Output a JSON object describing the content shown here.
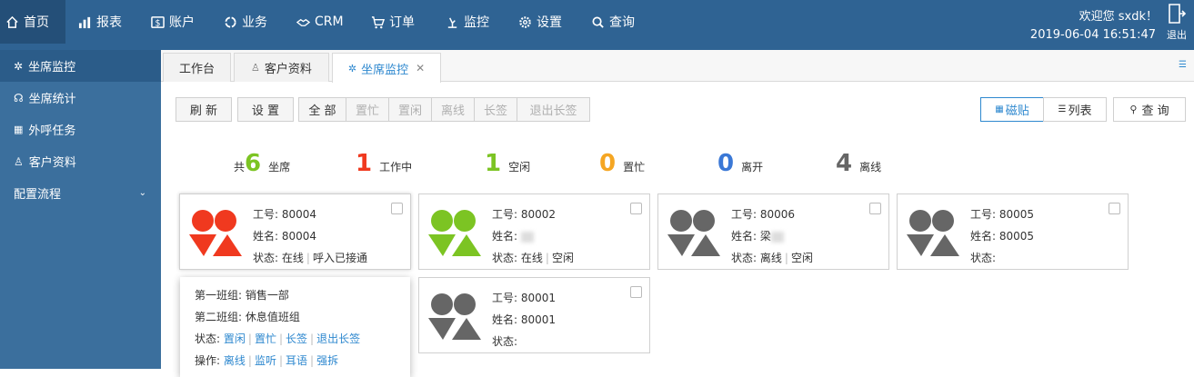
{
  "nav": {
    "items": [
      {
        "label": "首页",
        "icon": "home-icon"
      },
      {
        "label": "报表",
        "icon": "chart-icon"
      },
      {
        "label": "账户",
        "icon": "dollar-icon"
      },
      {
        "label": "业务",
        "icon": "refresh-icon"
      },
      {
        "label": "CRM",
        "icon": "handshake-icon"
      },
      {
        "label": "订单",
        "icon": "cart-icon"
      },
      {
        "label": "监控",
        "icon": "monitor-icon"
      },
      {
        "label": "设置",
        "icon": "gear-icon"
      },
      {
        "label": "查询",
        "icon": "search-icon"
      }
    ],
    "welcome": "欢迎您 sxdk！",
    "datetime": "2019-06-04 16:51:47",
    "logout": "退出"
  },
  "sidebar": {
    "items": [
      {
        "label": "坐席监控",
        "icon": "agent-icon"
      },
      {
        "label": "坐席统计",
        "icon": "headset-icon"
      },
      {
        "label": "外呼任务",
        "icon": "grid-icon"
      },
      {
        "label": "客户资料",
        "icon": "user-icon"
      },
      {
        "label": "配置流程",
        "icon": ""
      }
    ]
  },
  "tabs": [
    {
      "label": "工作台"
    },
    {
      "label": "客户资料"
    },
    {
      "label": "坐席监控"
    }
  ],
  "toolbar": {
    "refresh": "刷 新",
    "settings": "设 置",
    "filters": [
      "全 部",
      "置忙",
      "置闲",
      "离线",
      "长签",
      "退出长签"
    ],
    "view_tile": "磁贴",
    "view_list": "列表",
    "query": "查 询"
  },
  "stats": {
    "total_prefix": "共",
    "total": "6",
    "total_label": "坐席",
    "working": "1",
    "working_label": "工作中",
    "idle": "1",
    "idle_label": "空闲",
    "busy": "0",
    "busy_label": "置忙",
    "away": "0",
    "away_label": "离开",
    "offline": "4",
    "offline_label": "离线"
  },
  "colors": {
    "working": "#f0391f",
    "idle": "#7cc423",
    "busy": "#f5a623",
    "away": "#3a78d6",
    "offline": "#666666"
  },
  "agents": [
    {
      "id_label": "工号: 80004",
      "name_label": "姓名: 80004",
      "status_label": "状态:",
      "status": "在线",
      "detail": "呼入已接通",
      "color": "red"
    },
    {
      "id_label": "工号: 80002",
      "name_label": "姓名:",
      "status_label": "状态:",
      "status": "在线",
      "detail": "空闲",
      "color": "green"
    },
    {
      "id_label": "工号: 80006",
      "name_label": "姓名: 梁",
      "status_label": "状态:",
      "status": "离线",
      "detail": "空闲",
      "color": "gray"
    },
    {
      "id_label": "工号: 80005",
      "name_label": "姓名: 80005",
      "status_label": "状态:",
      "status": "",
      "detail": "",
      "color": "gray"
    },
    {
      "id_label": "工号: 80001",
      "name_label": "姓名: 80001",
      "status_label": "状态:",
      "status": "",
      "detail": "",
      "color": "gray"
    }
  ],
  "popup": {
    "group1": "第一班组: 销售一部",
    "group2": "第二班组: 休息值班组",
    "status_label": "状态:",
    "status_links": [
      "置闲",
      "置忙",
      "长签",
      "退出长签"
    ],
    "op_label": "操作:",
    "op_links": [
      "离线",
      "监听",
      "耳语",
      "强拆"
    ]
  }
}
